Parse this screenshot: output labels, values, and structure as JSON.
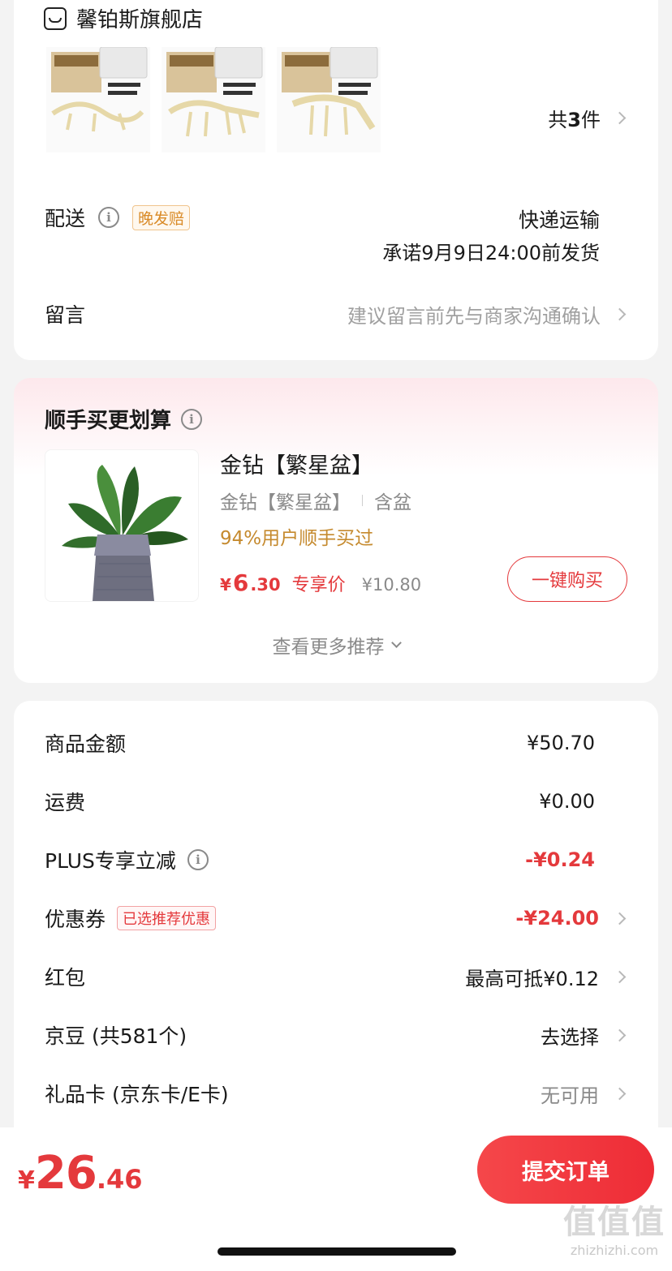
{
  "store": {
    "name": "馨铂斯旗舰店",
    "item_count_prefix": "共",
    "item_count": "3",
    "item_count_suffix": "件"
  },
  "delivery": {
    "label": "配送",
    "badge": "晚发赔",
    "method": "快递运输",
    "promise": "承诺9月9日24:00前发货"
  },
  "message": {
    "label": "留言",
    "placeholder": "建议留言前先与商家沟通确认"
  },
  "recommend": {
    "title": "顺手买更划算",
    "product": {
      "name": "金钻【繁星盆】",
      "spec": "金钻【繁星盆】",
      "spec2": "含盆",
      "stat": "94%用户顺手买过",
      "currency": "¥",
      "price_int": "6",
      "price_dec": ".30",
      "price_tag": "专享价",
      "orig_price": "¥10.80",
      "buy_label": "一键购买"
    },
    "more_label": "查看更多推荐"
  },
  "summary": {
    "goods_amount": {
      "label": "商品金额",
      "value": "¥50.70"
    },
    "shipping": {
      "label": "运费",
      "value": "¥0.00"
    },
    "plus": {
      "label": "PLUS专享立减",
      "value": "-¥0.24"
    },
    "coupon": {
      "label": "优惠券",
      "badge": "已选推荐优惠",
      "value": "-¥24.00"
    },
    "red_packet": {
      "label": "红包",
      "value": "最高可抵¥0.12"
    },
    "jd_beans": {
      "label": "京豆 (共581个)",
      "value": "去选择"
    },
    "gift_card": {
      "label": "礼品卡 (京东卡/E卡)",
      "value": "无可用"
    }
  },
  "footer": {
    "currency": "¥",
    "total_int": "26",
    "total_dec": ".46",
    "submit_label": "提交订单"
  },
  "watermark": {
    "text": "值值值",
    "site": "zhizhizhi.com"
  },
  "colors": {
    "accent_red": "#e4393c",
    "orange_text": "#c58a2e",
    "badge_orange": "#e08a2f",
    "submit_bg": "#f23a3f"
  },
  "icons": {
    "store": "store-icon",
    "info": "info-icon",
    "chevron": "chevron-right-icon",
    "expand": "chevron-down-icon"
  }
}
